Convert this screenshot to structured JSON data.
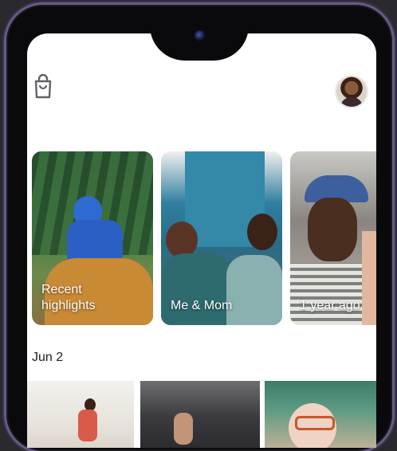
{
  "header": {
    "shop_icon": "shopping-bag-icon",
    "account_avatar": "account-avatar"
  },
  "highlights": [
    {
      "label": "Recent\nhighlights"
    },
    {
      "label": "Me & Mom"
    },
    {
      "label": "1 year ago"
    }
  ],
  "timeline": {
    "date": "Jun 2",
    "thumbnails": [
      "photo-1",
      "photo-2",
      "photo-3"
    ]
  },
  "colors": {
    "screen_bg": "#ffffff",
    "text_primary": "#202124",
    "frame_accent": "#6a5a86"
  }
}
